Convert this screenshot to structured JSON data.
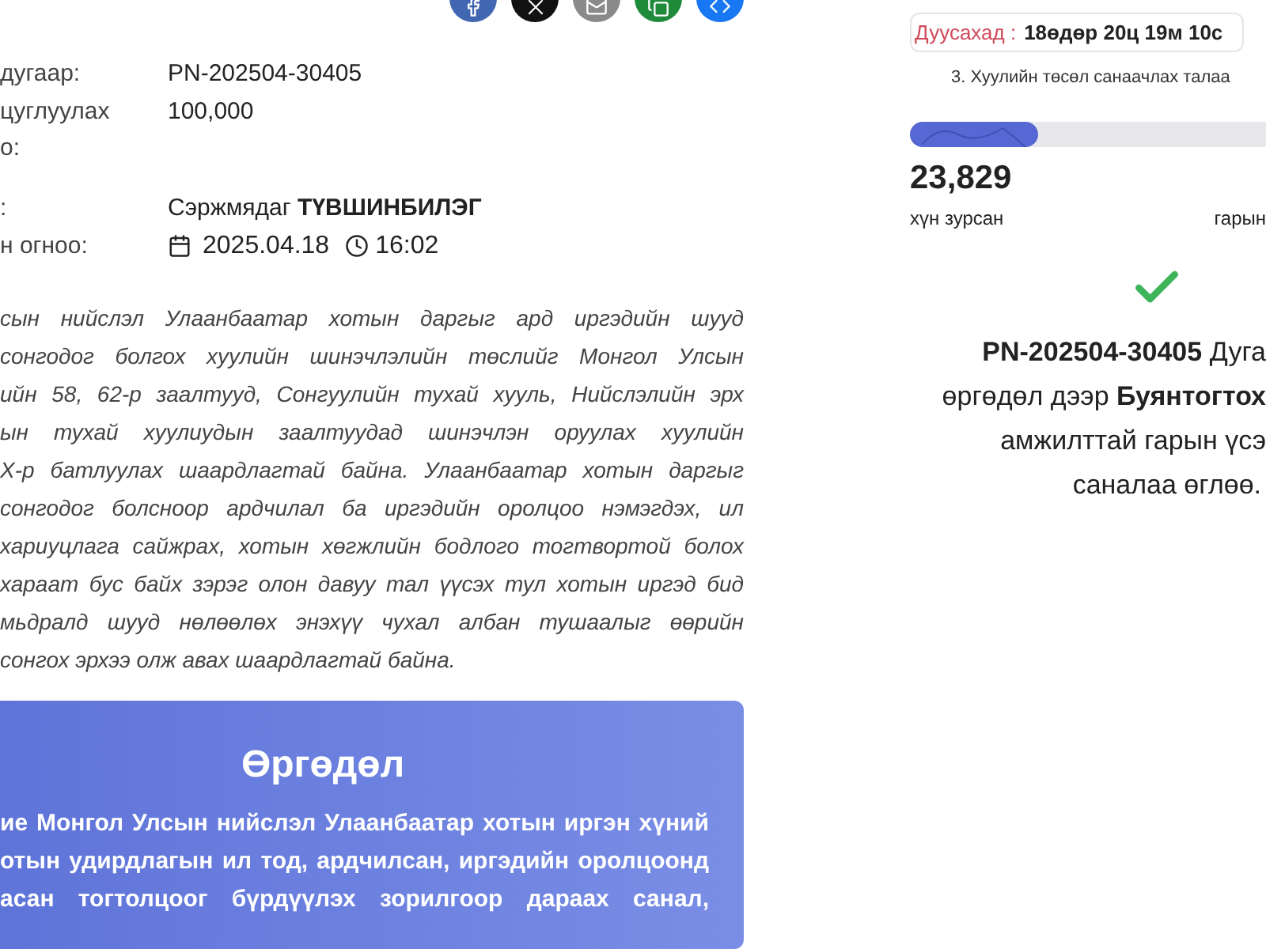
{
  "share_buttons": [
    {
      "kind": "facebook",
      "color": "#4267b2"
    },
    {
      "kind": "x",
      "color": "#111111"
    },
    {
      "kind": "email",
      "color": "#8a8a8a"
    },
    {
      "kind": "copy",
      "color": "#1e8a3a"
    },
    {
      "kind": "embed",
      "color": "#1877f2"
    }
  ],
  "details": [
    {
      "label_lines": [
        "дугаар:"
      ],
      "value": "PN-202504-30405",
      "kind": "text"
    },
    {
      "label_lines": [
        "цуглуулах",
        "о:"
      ],
      "value": "100,000",
      "kind": "text"
    },
    {
      "label_lines": [
        ":"
      ],
      "value": "Сэржмядаг **ТҮВШИНБИЛЭГ**",
      "kind": "text"
    },
    {
      "label_lines": [
        "н огноо:"
      ],
      "kind": "datetime",
      "date": "2025.04.18",
      "time": "16:02"
    }
  ],
  "description_lines": [
    "сын нийслэл Улаанбаатар хотын даргыг ард иргэдийн шууд",
    "сонгодог болгох хуулийн шинэчлэлийн төслийг Монгол Улсын",
    "ийн 58, 62-р заалтууд, Сонгуулийн тухай хууль, Нийслэлийн эрх",
    "ын тухай хуулиудын заалтуудад шинэчлэн оруулах хуулийн",
    "Х-р батлуулах шаардлагтай байна. Улаанбаатар хотын даргыг",
    "сонгодог болсноор ардчилал ба иргэдийн оролцоо нэмэгдэх, ил",
    "хариуцлага сайжрах, хотын хөгжлийн бодлого тогтвортой болох",
    "хараат бус байх зэрэг олон давуу тал үүсэх тул хотын иргэд бид",
    "мьдралд шууд нөлөөлөх энэхүү чухал албан тушаалыг өөрийн",
    "сонгох эрхээ олж авах шаардлагтай байна."
  ],
  "petition": {
    "title": "Өргөдөл",
    "lines": [
      "ие Монгол Улсын нийслэл Улаанбаатар хотын иргэн хүний",
      "отын удирдлагын ил тод, ардчилсан, иргэдийн оролцоонд",
      "асан тогтолцоог бүрдүүлэх зорилгоор дараах санал,"
    ]
  },
  "countdown": {
    "label": "Дуусахад :",
    "value": "18өдөр 20ц 19м 10с"
  },
  "category": "3. Хуулийн төсөл санаачлах талаа",
  "progress": {
    "level": 0.36
  },
  "signed": {
    "count": "23,829",
    "label": "хүн зурсан"
  },
  "column_2_label": "гарын",
  "success_lines": [
    "**PN-202504-30405** Дуга",
    "өргөдөл дээр **Буянтогтох**",
    "амжилттай гарын үсэ",
    "саналаа өглөө."
  ]
}
